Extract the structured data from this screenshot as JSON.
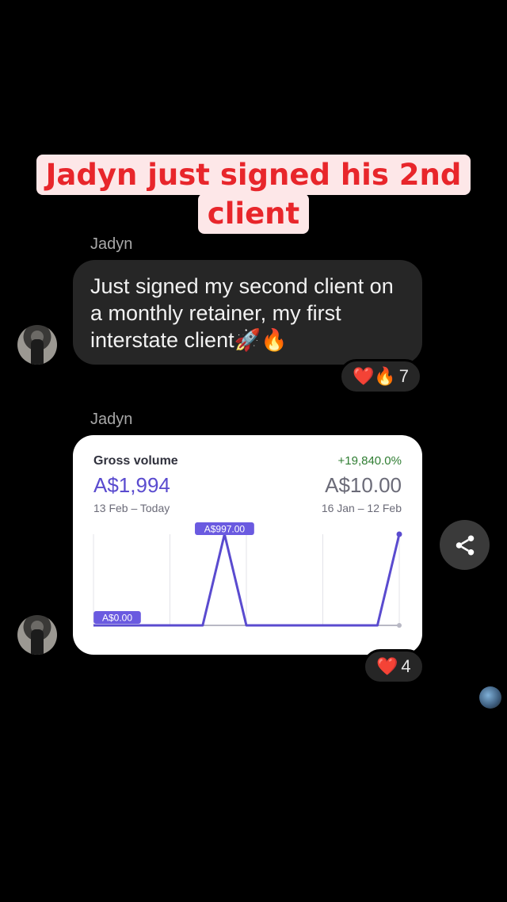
{
  "headline": {
    "line1": "Jadyn just signed his 2nd",
    "line2": "client"
  },
  "messages": [
    {
      "sender": "Jadyn",
      "text": "Just signed my second client on a monthly retainer, my first interstate client🚀🔥",
      "reactions": {
        "emojis": "❤️🔥",
        "count": "7"
      }
    },
    {
      "sender": "Jadyn",
      "reactions": {
        "emojis": "❤️",
        "count": "4"
      }
    }
  ],
  "card": {
    "title": "Gross volume",
    "growth": "+19,840.0%",
    "current_value": "A$1,994",
    "previous_value": "A$10.00",
    "current_range": "13 Feb – Today",
    "previous_range": "16 Jan – 12 Feb"
  },
  "chart_data": {
    "type": "line",
    "series": [
      {
        "values": [
          0,
          0,
          0,
          0,
          0,
          0,
          997,
          0,
          0,
          0,
          0,
          0,
          0,
          0,
          997
        ]
      },
      {
        "values": [
          0,
          0,
          0,
          0,
          0,
          0,
          0,
          0,
          0,
          0,
          0,
          0,
          0,
          0,
          0
        ]
      }
    ],
    "data_labels": {
      "peak": "A$997.00",
      "base": "A$0.00"
    },
    "colors": {
      "primary": "#5a4bcf",
      "previous": "#b8b8c4",
      "label_bg": "#6a5ae0"
    }
  },
  "icons": {
    "share": "share-icon"
  }
}
